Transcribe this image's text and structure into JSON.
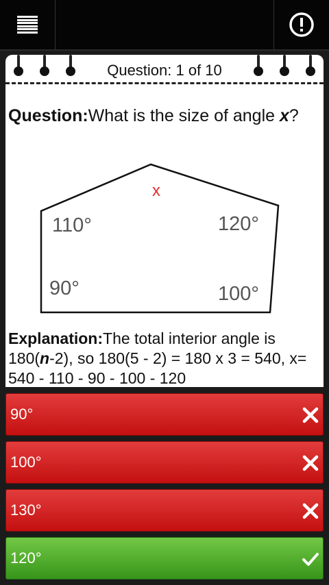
{
  "header": {
    "menu_icon": "menu-icon",
    "info_icon": "alert-info-icon"
  },
  "card": {
    "question_counter": "Question: 1 of 10",
    "question_label": "Question:",
    "question_text": "What is the size of angle",
    "question_var": "x",
    "question_end": "?",
    "diagram": {
      "angle_x": "x",
      "angle_a": "110°",
      "angle_b": "120°",
      "angle_c": "90°",
      "angle_d": "100°"
    },
    "explanation_label": "Explanation:",
    "explanation_text_1": "The total interior angle is 180(",
    "explanation_var": "n",
    "explanation_text_2": "-2), so 180(5 - 2) = 180 x 3 = 540, x= 540 - 110 - 90 - 100 - 120"
  },
  "answers": [
    {
      "label": "90°",
      "state": "wrong",
      "icon": "cross-icon"
    },
    {
      "label": "100°",
      "state": "wrong",
      "icon": "cross-icon"
    },
    {
      "label": "130°",
      "state": "wrong",
      "icon": "cross-icon"
    },
    {
      "label": "120°",
      "state": "correct",
      "icon": "check-icon"
    }
  ],
  "colors": {
    "wrong": "#d42020",
    "correct": "#4caf2a",
    "marker": "#e03030"
  }
}
